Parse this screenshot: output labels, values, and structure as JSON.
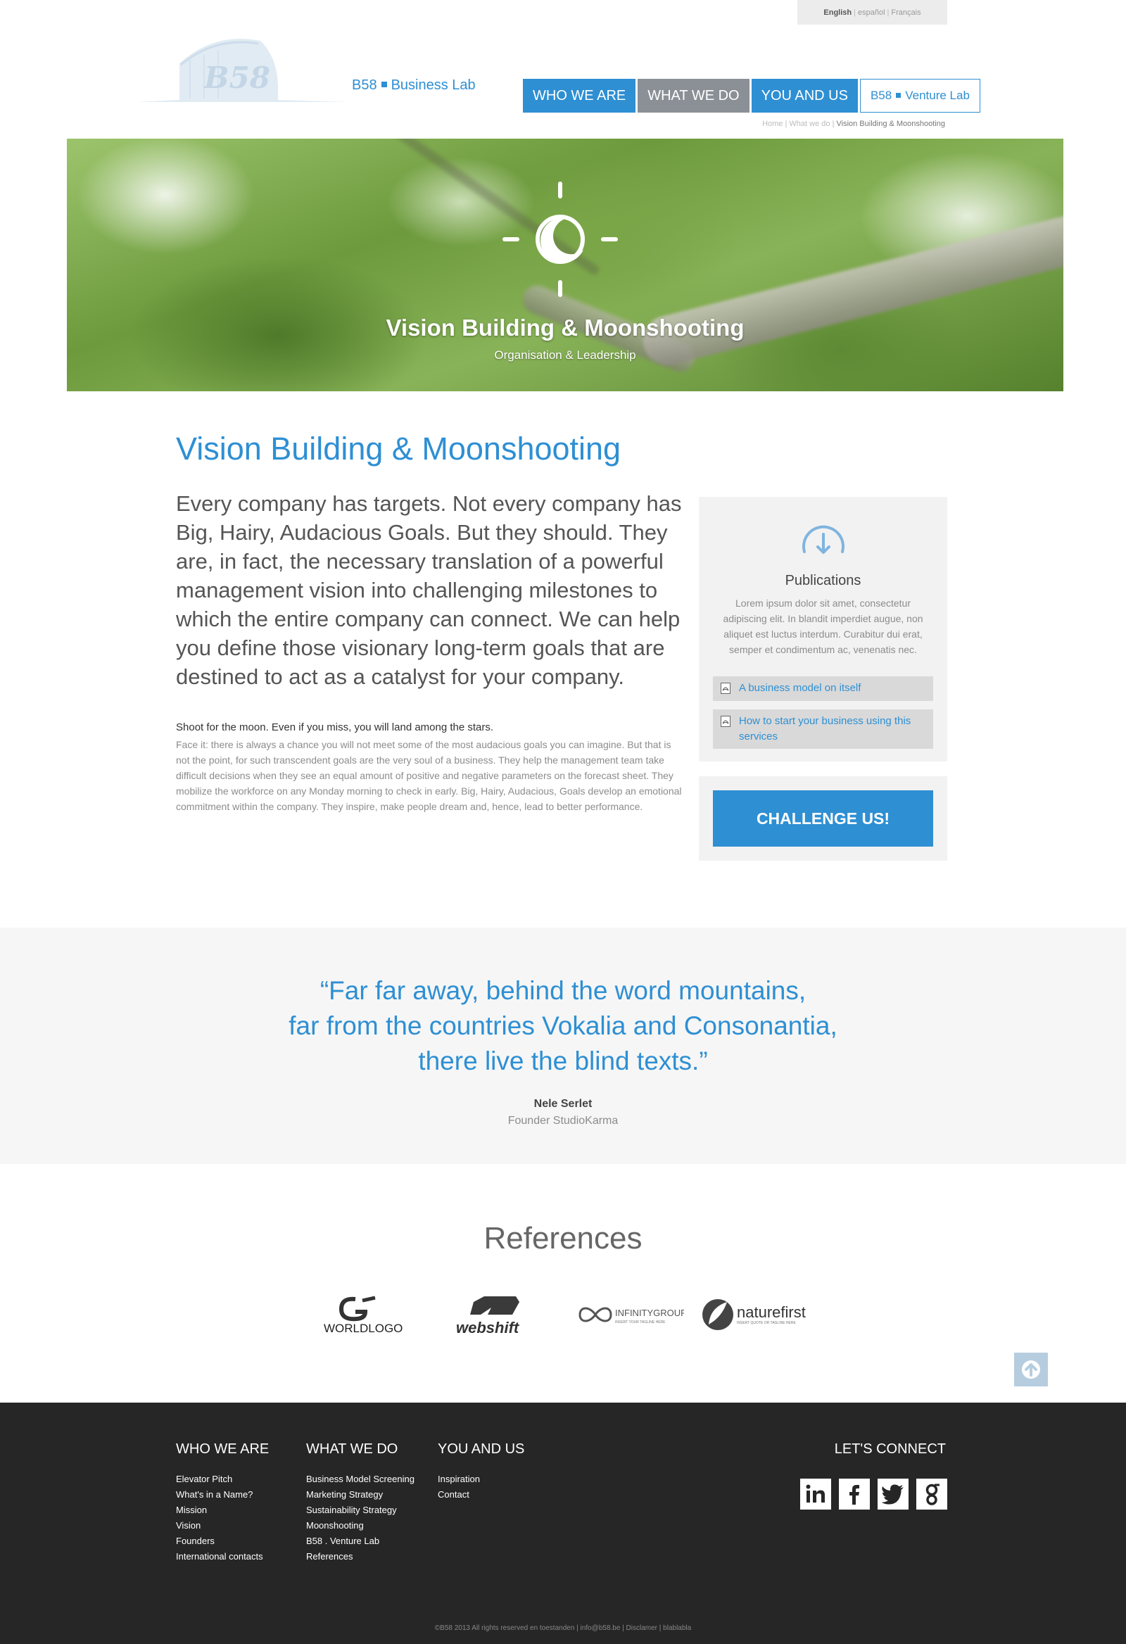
{
  "language_bar": {
    "active": "English",
    "others": [
      "español",
      "Français"
    ],
    "separator": "|"
  },
  "logo": {
    "mark_text": "B58",
    "name": "B58",
    "subtitle": "Business Lab"
  },
  "nav": {
    "items": [
      {
        "label": "WHO WE ARE",
        "style": "blue"
      },
      {
        "label": "WHAT WE DO",
        "style": "grey"
      },
      {
        "label": "YOU AND US",
        "style": "blue"
      }
    ],
    "venture": {
      "name": "B58",
      "subtitle": "Venture Lab"
    }
  },
  "breadcrumb": {
    "items": [
      "Home",
      "What we do"
    ],
    "separator": "|",
    "current": "Vision Building & Moonshooting"
  },
  "hero": {
    "title": "Vision Building & Moonshooting",
    "subtitle": "Organisation & Leadership",
    "icon": "moon-sun-icon"
  },
  "main": {
    "title": "Vision Building & Moonshooting",
    "lead": "Every company has targets. Not every company has Big, Hairy, Audacious Goals. But they should. They are, in fact, the necessary translation of a powerful management vision into challenging milestones to which the entire company can connect. We can help you define those visionary long-term goals that are destined to act as a catalyst for your company.",
    "quote_heading": "Shoot for the moon. Even if you miss, you will land among the stars.",
    "body": "Face it: there is always a chance you will not meet some of the most audacious goals you can imagine. But that is not the point, for such transcendent goals are the very soul of a business. They help the management team take difficult decisions when they see an equal amount of positive and negative parameters on the forecast sheet. They mobilize the workforce on any Monday morning to check in early. Big, Hairy, Audacious, Goals develop an emotional commitment within the company. They inspire, make people dream and, hence, lead to better performance."
  },
  "publications": {
    "title": "Publications",
    "text": "Lorem ipsum dolor sit amet, consectetur adipiscing elit. In blandit imperdiet augue, non aliquet est luctus interdum. Curabitur dui erat, semper et condimentum ac, venenatis nec.",
    "links": [
      "A business model on itself",
      "How to start your business using this services"
    ]
  },
  "cta": {
    "label": "CHALLENGE US!"
  },
  "testimonial": {
    "lines": [
      "“Far far away, behind the word mountains,",
      "far from the countries Vokalia and Consonantia,",
      "there live the blind texts.”"
    ],
    "name": "Nele Serlet",
    "role": "Founder StudioKarma"
  },
  "references": {
    "title": "References",
    "logos": [
      "WORLDLOGO",
      "webshift",
      "INFINITYGROUP",
      "naturefirst"
    ],
    "infinity_tagline": "INSERT YOUR TAGLINE HERE",
    "nature_tagline": "INSERT QUOTE OR TAGLINE HERE"
  },
  "footer": {
    "columns": [
      {
        "heading": "WHO WE ARE",
        "links": [
          "Elevator Pitch",
          "What's in a Name?",
          "Mission",
          "Vision",
          "Founders",
          "International contacts"
        ]
      },
      {
        "heading": "WHAT WE DO",
        "links": [
          "Business Model Screening",
          "Marketing Strategy",
          "Sustainability Strategy",
          "Moonshooting",
          "B58 . Venture Lab",
          "References"
        ]
      },
      {
        "heading": "YOU AND US",
        "links": [
          "Inspiration",
          "Contact"
        ]
      }
    ],
    "connect_heading": "LET'S CONNECT",
    "social": [
      "linkedin-icon",
      "facebook-icon",
      "twitter-icon",
      "google-icon"
    ],
    "copyright": "©B58 2013 All rights reserved en toestanden | info@b58.be | Disclamer | blablabla"
  },
  "colors": {
    "accent": "#2e8fd3",
    "nav_grey": "#8a9096",
    "footer_bg": "#262626"
  }
}
